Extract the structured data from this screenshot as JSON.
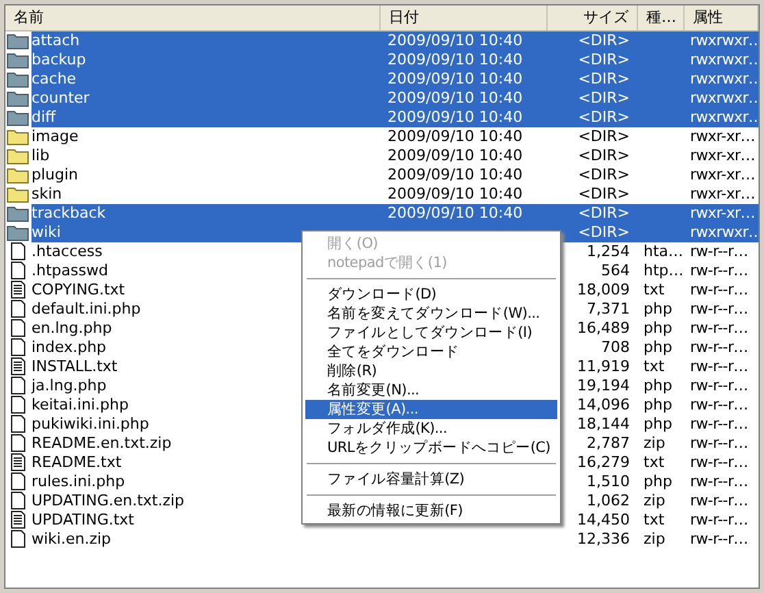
{
  "columns": [
    {
      "label": "名前"
    },
    {
      "label": "日付"
    },
    {
      "label": "サイズ"
    },
    {
      "label": "種…"
    },
    {
      "label": "属性"
    }
  ],
  "rows": [
    {
      "kind": "folder",
      "name": "attach",
      "date": "2009/09/10 10:40",
      "size": "<DIR>",
      "attributes": "rwxrwxr…",
      "selected": true
    },
    {
      "kind": "folder",
      "name": "backup",
      "date": "2009/09/10 10:40",
      "size": "<DIR>",
      "attributes": "rwxrwxr…",
      "selected": true
    },
    {
      "kind": "folder",
      "name": "cache",
      "date": "2009/09/10 10:40",
      "size": "<DIR>",
      "attributes": "rwxrwxr…",
      "selected": true
    },
    {
      "kind": "folder",
      "name": "counter",
      "date": "2009/09/10 10:40",
      "size": "<DIR>",
      "attributes": "rwxrwxr…",
      "selected": true
    },
    {
      "kind": "folder",
      "name": "diff",
      "date": "2009/09/10 10:40",
      "size": "<DIR>",
      "attributes": "rwxrwxr…",
      "selected": true
    },
    {
      "kind": "folder",
      "name": "image",
      "date": "2009/09/10 10:40",
      "size": "<DIR>",
      "attributes": "rwxr-xr…",
      "selected": false
    },
    {
      "kind": "folder",
      "name": "lib",
      "date": "2009/09/10 10:40",
      "size": "<DIR>",
      "attributes": "rwxr-xr…",
      "selected": false
    },
    {
      "kind": "folder",
      "name": "plugin",
      "date": "2009/09/10 10:40",
      "size": "<DIR>",
      "attributes": "rwxr-xr…",
      "selected": false
    },
    {
      "kind": "folder",
      "name": "skin",
      "date": "2009/09/10 10:40",
      "size": "<DIR>",
      "attributes": "rwxr-xr…",
      "selected": false
    },
    {
      "kind": "folder",
      "name": "trackback",
      "date": "2009/09/10 10:40",
      "size": "<DIR>",
      "attributes": "rwxr-xr…",
      "selected": true
    },
    {
      "kind": "folder",
      "name": "wiki",
      "size": "<DIR>",
      "attributes": "rwxrwxr…",
      "selected": true
    },
    {
      "kind": "file",
      "name": ".htaccess",
      "size": "1,254",
      "type": "hta…",
      "attributes": "rw-r--r…",
      "selected": false
    },
    {
      "kind": "file",
      "name": ".htpasswd",
      "size": "564",
      "type": "htp…",
      "attributes": "rw-r--r…",
      "selected": false
    },
    {
      "kind": "text",
      "name": "COPYING.txt",
      "size": "18,009",
      "type": "txt",
      "attributes": "rw-r--r…",
      "selected": false
    },
    {
      "kind": "file",
      "name": "default.ini.php",
      "size": "7,371",
      "type": "php",
      "attributes": "rw-r--r…",
      "selected": false
    },
    {
      "kind": "file",
      "name": "en.lng.php",
      "size": "16,489",
      "type": "php",
      "attributes": "rw-r--r…",
      "selected": false
    },
    {
      "kind": "file",
      "name": "index.php",
      "size": "708",
      "type": "php",
      "attributes": "rw-r--r…",
      "selected": false
    },
    {
      "kind": "text",
      "name": "INSTALL.txt",
      "size": "11,919",
      "type": "txt",
      "attributes": "rw-r--r…",
      "selected": false
    },
    {
      "kind": "file",
      "name": "ja.lng.php",
      "size": "19,194",
      "type": "php",
      "attributes": "rw-r--r…",
      "selected": false
    },
    {
      "kind": "file",
      "name": "keitai.ini.php",
      "size": "14,096",
      "type": "php",
      "attributes": "rw-r--r…",
      "selected": false
    },
    {
      "kind": "file",
      "name": "pukiwiki.ini.php",
      "size": "18,144",
      "type": "php",
      "attributes": "rw-r--r…",
      "selected": false
    },
    {
      "kind": "file",
      "name": "README.en.txt.zip",
      "size": "2,787",
      "type": "zip",
      "attributes": "rw-r--r…",
      "selected": false
    },
    {
      "kind": "text",
      "name": "README.txt",
      "size": "16,279",
      "type": "txt",
      "attributes": "rw-r--r…",
      "selected": false
    },
    {
      "kind": "file",
      "name": "rules.ini.php",
      "size": "1,510",
      "type": "php",
      "attributes": "rw-r--r…",
      "selected": false
    },
    {
      "kind": "file",
      "name": "UPDATING.en.txt.zip",
      "size": "1,062",
      "type": "zip",
      "attributes": "rw-r--r…",
      "selected": false
    },
    {
      "kind": "text",
      "name": "UPDATING.txt",
      "size": "14,450",
      "type": "txt",
      "attributes": "rw-r--r…",
      "selected": false
    },
    {
      "kind": "file",
      "name": "wiki.en.zip",
      "size": "12,336",
      "type": "zip",
      "attributes": "rw-r--r…",
      "selected": false
    }
  ],
  "context_menu": [
    {
      "kind": "item",
      "label": "開く(O)",
      "disabled": true,
      "selected": false
    },
    {
      "kind": "item",
      "label": "notepadで開く(1)",
      "disabled": true,
      "selected": false
    },
    {
      "kind": "separator"
    },
    {
      "kind": "item",
      "label": "ダウンロード(D)",
      "disabled": false,
      "selected": false
    },
    {
      "kind": "item",
      "label": "名前を変えてダウンロード(W)...",
      "disabled": false,
      "selected": false
    },
    {
      "kind": "item",
      "label": "ファイルとしてダウンロード(I)",
      "disabled": false,
      "selected": false
    },
    {
      "kind": "item",
      "label": "全てをダウンロード",
      "disabled": false,
      "selected": false
    },
    {
      "kind": "item",
      "label": "削除(R)",
      "disabled": false,
      "selected": false
    },
    {
      "kind": "item",
      "label": "名前変更(N)...",
      "disabled": false,
      "selected": false
    },
    {
      "kind": "item",
      "label": "属性変更(A)...",
      "disabled": false,
      "selected": true
    },
    {
      "kind": "item",
      "label": "フォルダ作成(K)...",
      "disabled": false,
      "selected": false
    },
    {
      "kind": "item",
      "label": "URLをクリップボードへコピー(C)",
      "disabled": false,
      "selected": false
    },
    {
      "kind": "separator"
    },
    {
      "kind": "item",
      "label": "ファイル容量計算(Z)",
      "disabled": false,
      "selected": false
    },
    {
      "kind": "separator"
    },
    {
      "kind": "item",
      "label": "最新の情報に更新(F)",
      "disabled": false,
      "selected": false
    }
  ]
}
